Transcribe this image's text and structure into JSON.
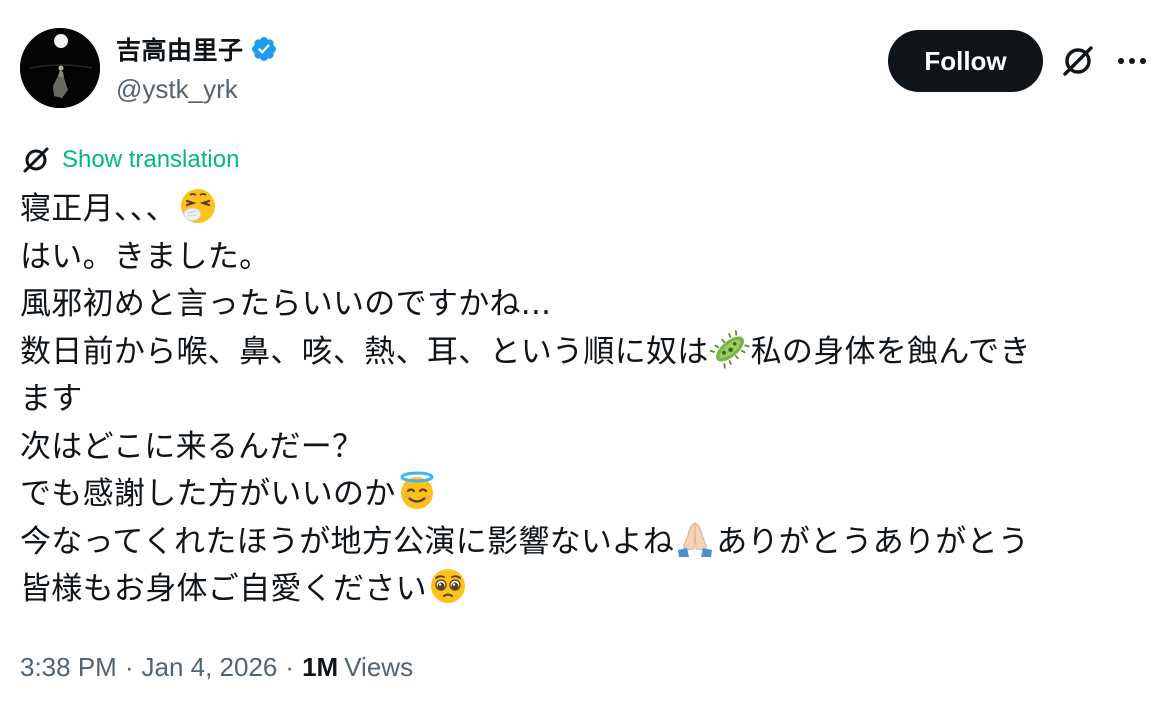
{
  "author": {
    "display_name": "吉高由里子",
    "handle": "@ystk_yrk",
    "verified": true,
    "verified_color": "#1d9bf0"
  },
  "actions": {
    "follow_label": "Follow",
    "grok_icon": "grok-icon",
    "more_icon": "more-horizontal-icon"
  },
  "translation": {
    "label": "Show translation",
    "icon": "translate-icon",
    "color": "#00ba7c"
  },
  "tweet": {
    "lines": [
      {
        "text": "寝正月、、、",
        "emoji_after": "sneezing-face-emoji"
      },
      {
        "text": "はい。きました。"
      },
      {
        "text": "風邪初めと言ったらいいのですかね..."
      },
      {
        "text": "数日前から喉、鼻、咳、熱、耳、という順に奴は",
        "emoji_after": "microbe-emoji",
        "text_after": "私の身体を蝕んでき"
      },
      {
        "text": "ます"
      },
      {
        "text": "次はどこに来るんだー？"
      },
      {
        "text": "でも感謝した方がいいのか",
        "emoji_after": "halo-face-emoji"
      },
      {
        "text": "今なってくれたほうが地方公演に影響ないよね",
        "emoji_after": "folded-hands-emoji",
        "text_after": "ありがとうありがとう"
      },
      {
        "text": "皆様もお身体ご自愛ください",
        "emoji_after": "pleading-face-emoji"
      }
    ]
  },
  "meta": {
    "time": "3:38 PM",
    "separator": "·",
    "date": "Jan 4, 2026",
    "views_count": "1M",
    "views_label": "Views"
  },
  "colors": {
    "text_primary": "#0f1419",
    "text_secondary": "#536471",
    "follow_bg": "#0f1419",
    "follow_text": "#ffffff"
  }
}
